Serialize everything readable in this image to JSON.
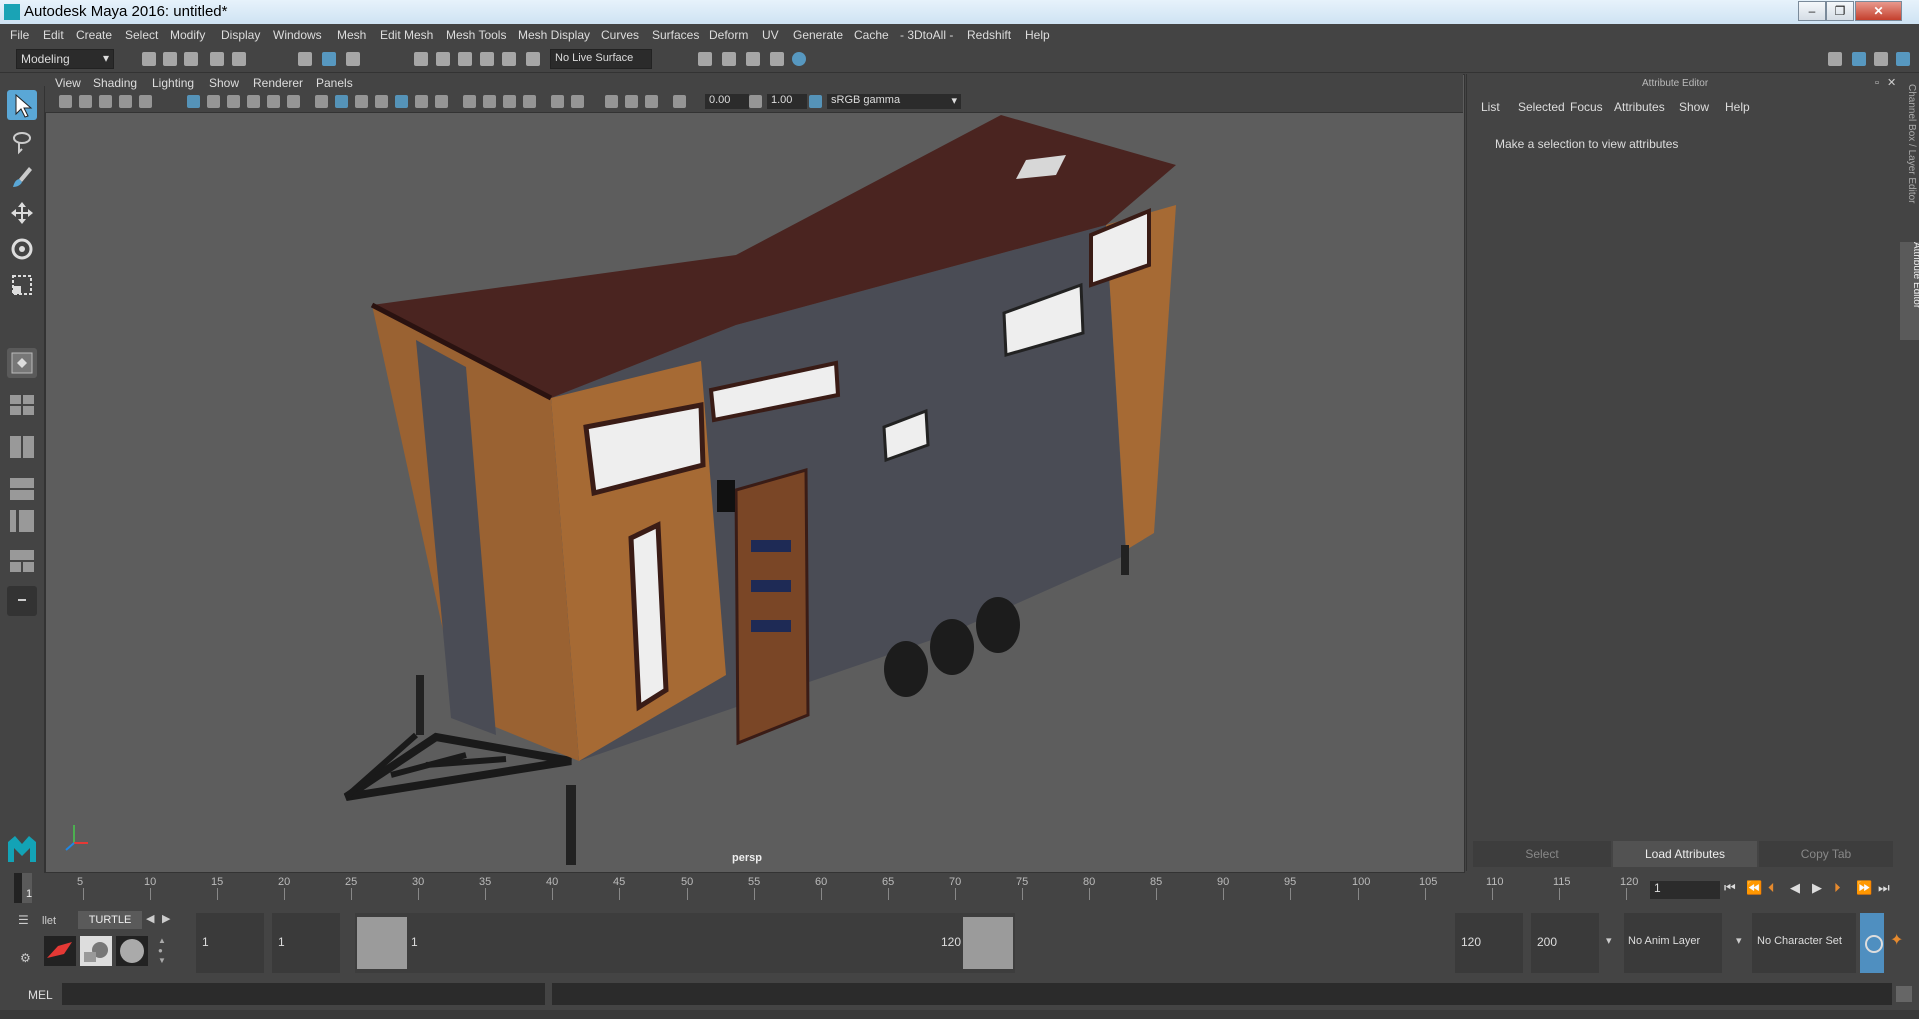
{
  "window": {
    "title": "Autodesk Maya 2016: untitled*",
    "min": "–",
    "max": "❐",
    "close": "✕"
  },
  "menu": [
    "File",
    "Edit",
    "Create",
    "Select",
    "Modify",
    "Display",
    "Windows",
    "Mesh",
    "Edit Mesh",
    "Mesh Tools",
    "Mesh Display",
    "Curves",
    "Surfaces",
    "Deform",
    "UV",
    "Generate",
    "Cache",
    "- 3DtoAll -",
    "Redshift",
    "Help"
  ],
  "toolbar": {
    "mode": "Modeling",
    "live_surface": "No Live Surface"
  },
  "viewport": {
    "menu": [
      "View",
      "Shading",
      "Lighting",
      "Show",
      "Renderer",
      "Panels"
    ],
    "exposure": "0.00",
    "gamma": "1.00",
    "color_space": "sRGB gamma",
    "camera_label": "persp"
  },
  "attribute_editor": {
    "title": "Attribute Editor",
    "menu": [
      "List",
      "Selected",
      "Focus",
      "Attributes",
      "Show",
      "Help"
    ],
    "message": "Make a selection to view attributes",
    "buttons": {
      "select": "Select",
      "load": "Load Attributes",
      "copy": "Copy Tab"
    },
    "side_tabs": {
      "channel_box": "Channel Box / Layer Editor",
      "attribute_editor": "Attribute Editor"
    }
  },
  "timeline": {
    "ticks": [
      "5",
      "10",
      "15",
      "20",
      "25",
      "30",
      "35",
      "40",
      "45",
      "50",
      "55",
      "60",
      "65",
      "70",
      "75",
      "80",
      "85",
      "90",
      "95",
      "100",
      "105",
      "110",
      "115",
      "120"
    ],
    "start_tick": "1",
    "current_frame": "1"
  },
  "shelf": {
    "tabs": [
      "llet",
      "TURTLE"
    ]
  },
  "range": {
    "start": "1",
    "start2": "1",
    "inner_start": "1",
    "inner_end": "120",
    "end": "120",
    "end2": "200",
    "anim_layer": "No Anim Layer",
    "char_set": "No Character Set"
  },
  "mel": {
    "label": "MEL"
  },
  "colors": {
    "accent": "#5aa7d6",
    "roof": "#4a2420",
    "wood": "#a66a34",
    "siding": "#4a4c55"
  }
}
